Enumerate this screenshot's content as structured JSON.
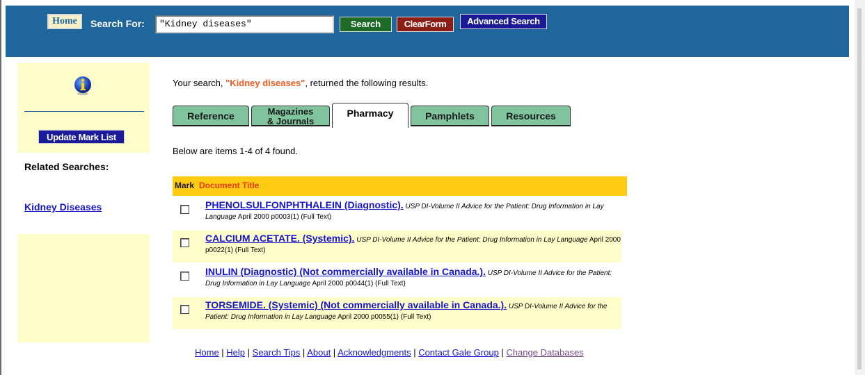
{
  "toolbar": {
    "home_label": "Home",
    "search_label": "Search For:",
    "search_value": "\"Kidney diseases\"",
    "search_button": "Search",
    "clear_button": "ClearForm",
    "advanced_button": "Advanced Search"
  },
  "sidebar": {
    "update_button": "Update Mark List",
    "related_heading": "Related Searches:",
    "related_link": "Kidney Diseases"
  },
  "main": {
    "intro_prefix": "Your search, ",
    "intro_query": "\"Kidney diseases\"",
    "intro_suffix": ", returned the following results.",
    "tabs": [
      {
        "label": "Reference"
      },
      {
        "label_line1": "Magazines",
        "label_line2": "& Journals"
      },
      {
        "label": "Pharmacy"
      },
      {
        "label": "Pamphlets"
      },
      {
        "label": "Resources"
      }
    ],
    "count_text": "Below are items 1-4 of 4 found.",
    "table_headers": {
      "mark": "Mark",
      "title": "Document Title"
    },
    "results": [
      {
        "title": "PHENOLSULFONPHTHALEIN (Diagnostic).",
        "source": "USP DI-Volume II Advice for the Patient: Drug Information in Lay Language",
        "meta": "April 2000 p0003(1) (Full Text)"
      },
      {
        "title": "CALCIUM ACETATE. (Systemic).",
        "source": "USP DI-Volume II Advice for the Patient: Drug Information in Lay Language",
        "meta": "April 2000 p0022(1) (Full Text)"
      },
      {
        "title": "INULIN (Diagnostic) (Not commercially available in Canada.).",
        "source": "USP DI-Volume II Advice for the Patient: Drug Information in Lay Language",
        "meta": "April 2000 p0044(1) (Full Text)"
      },
      {
        "title": "TORSEMIDE. (Systemic) (Not commercially available in Canada.).",
        "source": "USP DI-Volume II Advice for the Patient: Drug Information in Lay Language",
        "meta": "April 2000 p0055(1) (Full Text)"
      }
    ]
  },
  "footer": {
    "links": [
      "Home",
      "Help",
      "Search Tips",
      "About",
      "Acknowledgments",
      "Contact Gale Group",
      "Change Databases"
    ],
    "separator": " | "
  },
  "colors": {
    "topbar": "#1f669d",
    "sidebar_bg": "#fffdc9",
    "header_bar": "#ffcc11",
    "tab_green": "#7fc49d",
    "link": "#1515cc",
    "query_orange": "#f05a1e"
  }
}
